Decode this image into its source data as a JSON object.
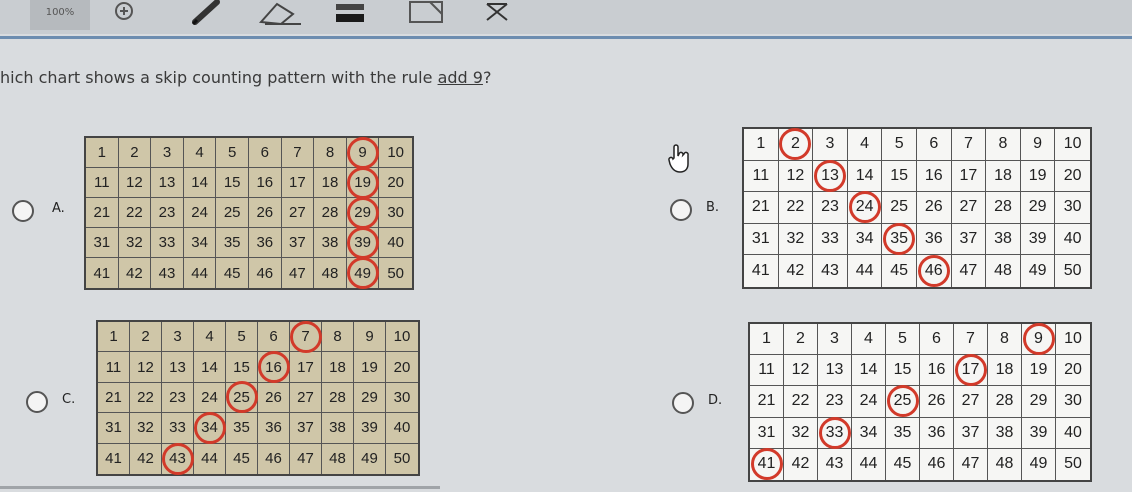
{
  "toolbar": {
    "zoom_label": "100%",
    "tools": [
      "zoom-in-icon",
      "pencil-icon",
      "eraser-icon",
      "highlighter-icon",
      "note-icon",
      "close-icon"
    ]
  },
  "question": {
    "prefix": "hich chart shows a skip counting pattern with the rule ",
    "rule": "add 9",
    "suffix": "?"
  },
  "options": [
    {
      "letter": "A.",
      "circled": [
        9,
        19,
        29,
        39,
        49
      ]
    },
    {
      "letter": "B.",
      "circled": [
        2,
        13,
        24,
        35,
        46
      ]
    },
    {
      "letter": "C.",
      "circled": [
        7,
        16,
        25,
        34,
        43
      ]
    },
    {
      "letter": "D.",
      "circled": [
        9,
        17,
        25,
        33,
        41
      ]
    }
  ],
  "colors": {
    "circle": "#d23a2a",
    "chart_fill_a": "#cfc6a8",
    "chart_fill_b": "#f6f6f4"
  }
}
